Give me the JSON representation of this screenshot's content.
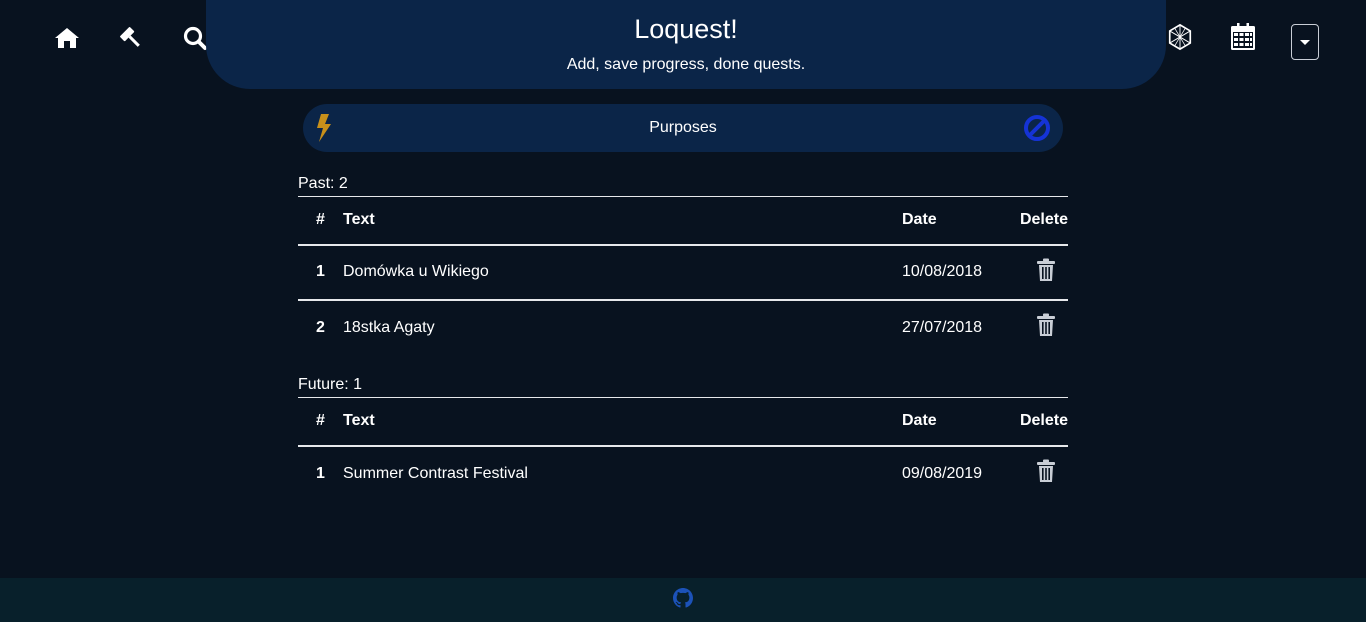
{
  "nav": {
    "left_icons": [
      "home-icon",
      "gavel-icon",
      "search-icon"
    ],
    "right_icons": [
      "network-icon",
      "calendar-icon"
    ],
    "dropdown": "caret-down-icon"
  },
  "header": {
    "title": "Loquest!",
    "subtitle": "Add, save progress, done quests."
  },
  "purposes": {
    "label": "Purposes",
    "left_icon": "bolt-icon",
    "right_icon": "ban-icon"
  },
  "past": {
    "label": "Past: 2",
    "columns": {
      "num": "#",
      "text": "Text",
      "date": "Date",
      "delete": "Delete"
    },
    "rows": [
      {
        "num": "1",
        "text": "Domówka u Wikiego",
        "date": "10/08/2018"
      },
      {
        "num": "2",
        "text": "18stka Agaty",
        "date": "27/07/2018"
      }
    ]
  },
  "future": {
    "label": "Future: 1",
    "columns": {
      "num": "#",
      "text": "Text",
      "date": "Date",
      "delete": "Delete"
    },
    "rows": [
      {
        "num": "1",
        "text": "Summer Contrast Festival",
        "date": "09/08/2019"
      }
    ]
  },
  "footer": {
    "icon": "github-icon"
  },
  "colors": {
    "background": "#08121f",
    "banner": "#0b2548",
    "footer": "#08202b",
    "bolt": "#c8901a",
    "ban": "#1533d6",
    "github": "#1c52b8",
    "trash": "#c9ced6"
  }
}
